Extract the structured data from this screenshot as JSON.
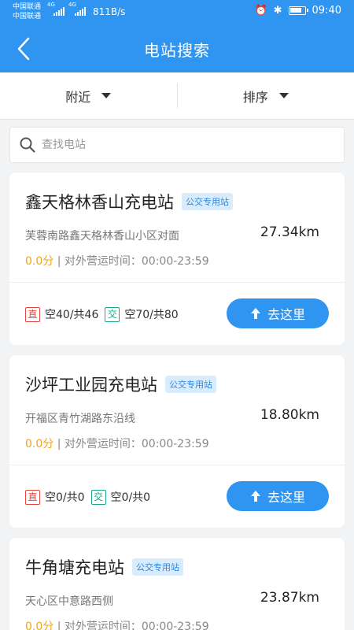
{
  "status_bar": {
    "carrier_1": "中国联通",
    "carrier_2": "中国联通",
    "signal_1": "4G",
    "signal_2": "4G",
    "net_speed": "811B/s",
    "time": "09:40"
  },
  "header": {
    "title": "电站搜索"
  },
  "filters": {
    "nearby": "附近",
    "sort": "排序"
  },
  "search": {
    "placeholder": "查找电站"
  },
  "accent": "#2f95f1",
  "stations": [
    {
      "name": "鑫天格林香山充电站",
      "badge": "公交专用站",
      "address": "芙蓉南路鑫天格林香山小区对面",
      "distance": "27.34km",
      "score": "0.0分",
      "hours": " | 对外营运时间：00:00-23:59",
      "dc_label": "直",
      "dc_slots": "空40/共46",
      "ac_label": "交",
      "ac_slots": "空70/共80",
      "go_label": "去这里"
    },
    {
      "name": "沙坪工业园充电站",
      "badge": "公交专用站",
      "address": "开福区青竹湖路东沿线",
      "distance": "18.80km",
      "score": "0.0分",
      "hours": " | 对外营运时间：00:00-23:59",
      "dc_label": "直",
      "dc_slots": "空0/共0",
      "ac_label": "交",
      "ac_slots": "空0/共0",
      "go_label": "去这里"
    },
    {
      "name": "牛角塘充电站",
      "badge": "公交专用站",
      "address": "天心区中意路西侧",
      "distance": "23.87km",
      "score": "0.0分",
      "hours": " | 对外营运时间：00:00-23:59"
    }
  ]
}
